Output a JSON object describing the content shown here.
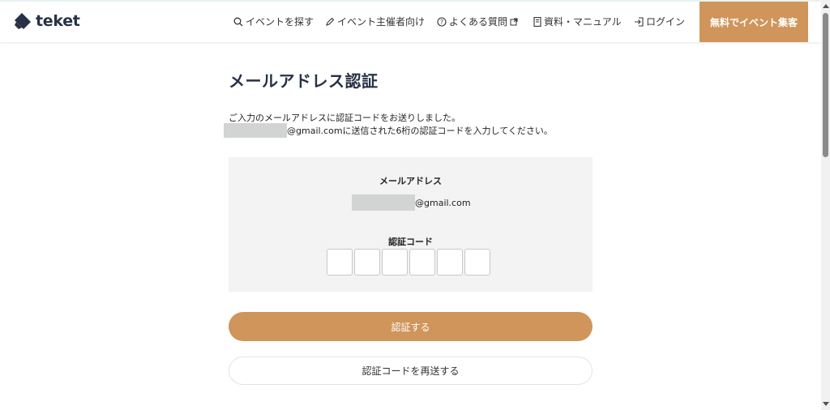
{
  "header": {
    "logo_text": "teket",
    "nav": {
      "search_label": "イベントを探す",
      "organizer_label": "イベント主催者向け",
      "faq_label": "よくある質問",
      "docs_label": "資料・マニュアル",
      "login_label": "ログイン"
    },
    "cta_label": "無料でイベント集客"
  },
  "main": {
    "title": "メールアドレス認証",
    "description_line1": "ご入力のメールアドレスに認証コードをお送りしました。",
    "description_line2_suffix": "@gmail.comに送信された6桁の認証コードを入力してください。",
    "panel": {
      "email_label": "メールアドレス",
      "email_domain": "@gmail.com",
      "code_label": "認証コード",
      "code_digits": [
        "",
        "",
        "",
        "",
        "",
        ""
      ]
    },
    "verify_button": "認証する",
    "resend_button": "認証コードを再送する"
  },
  "colors": {
    "accent": "#cf955a",
    "title": "#273246",
    "panel_bg": "#f3f3f3",
    "mask": "#d2d3d3"
  }
}
